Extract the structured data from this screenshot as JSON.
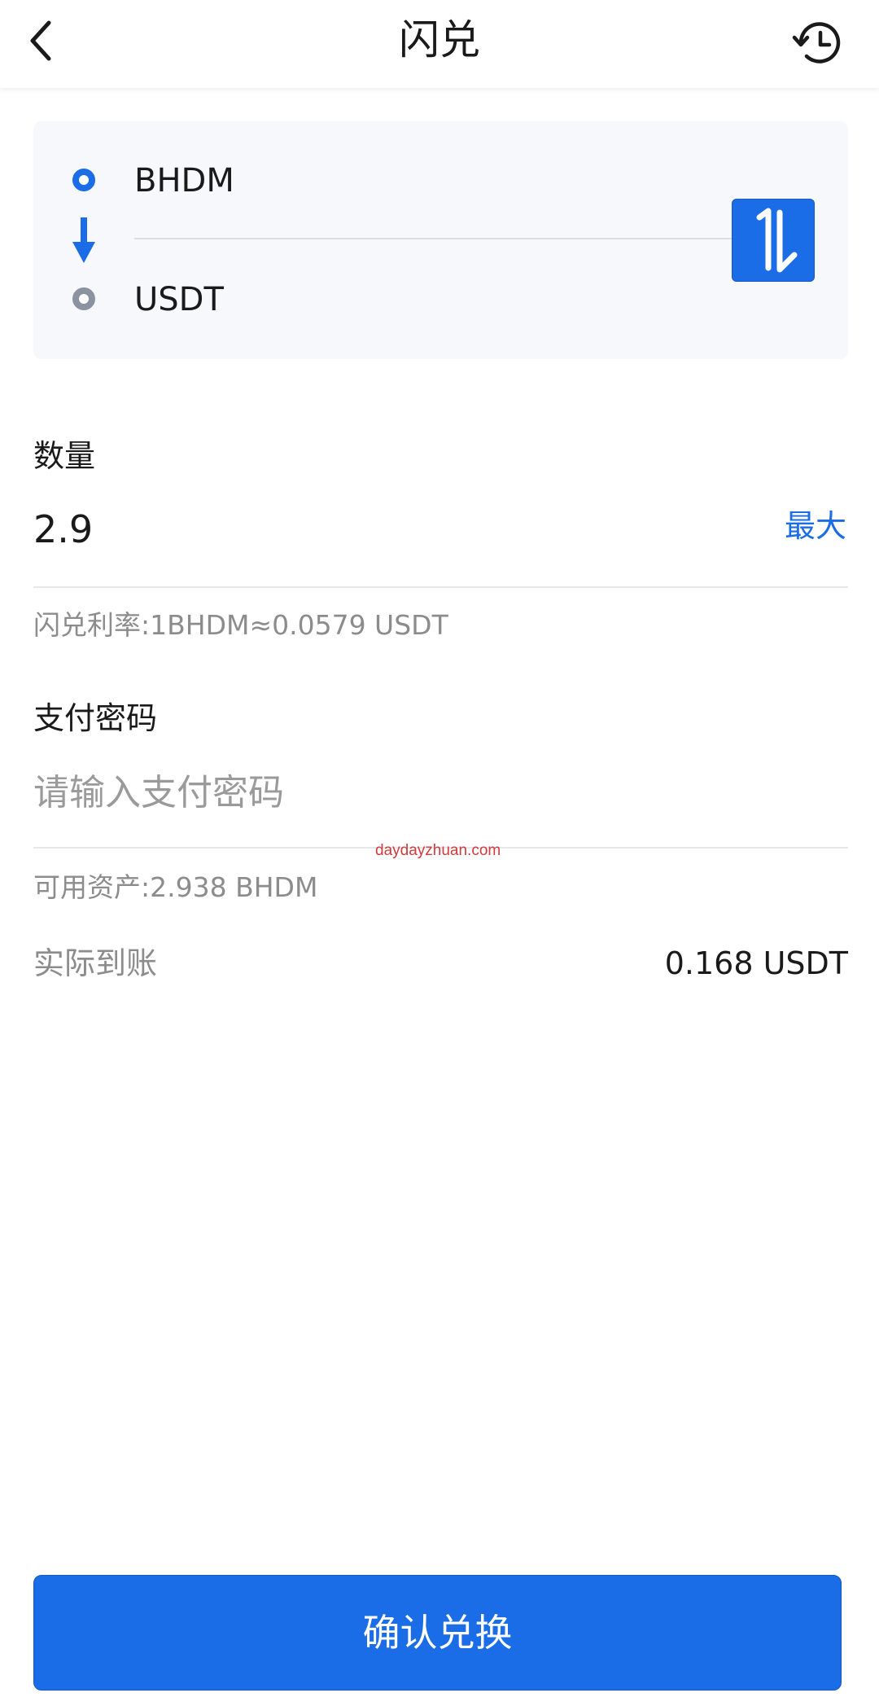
{
  "header": {
    "title": "闪兑",
    "back_icon": "chevron-left-icon",
    "history_icon": "history-clock-icon"
  },
  "pair": {
    "from_coin": "BHDM",
    "to_coin": "USDT",
    "swap_icon": "swap-vertical-icon"
  },
  "amount": {
    "label": "数量",
    "value": "2.9",
    "max_label": "最大"
  },
  "rate_text": "闪兑利率:1BHDM≈0.0579 USDT",
  "password": {
    "label": "支付密码",
    "placeholder": "请输入支付密码"
  },
  "watermark": "daydayzhuan.com",
  "available_text": "可用资产:2.938 BHDM",
  "receive": {
    "label": "实际到账",
    "value": "0.168 USDT"
  },
  "confirm_label": "确认兑换",
  "colors": {
    "accent": "#1a6de6",
    "muted_text": "#8c8c8c",
    "card_bg": "#f6f8fc"
  }
}
